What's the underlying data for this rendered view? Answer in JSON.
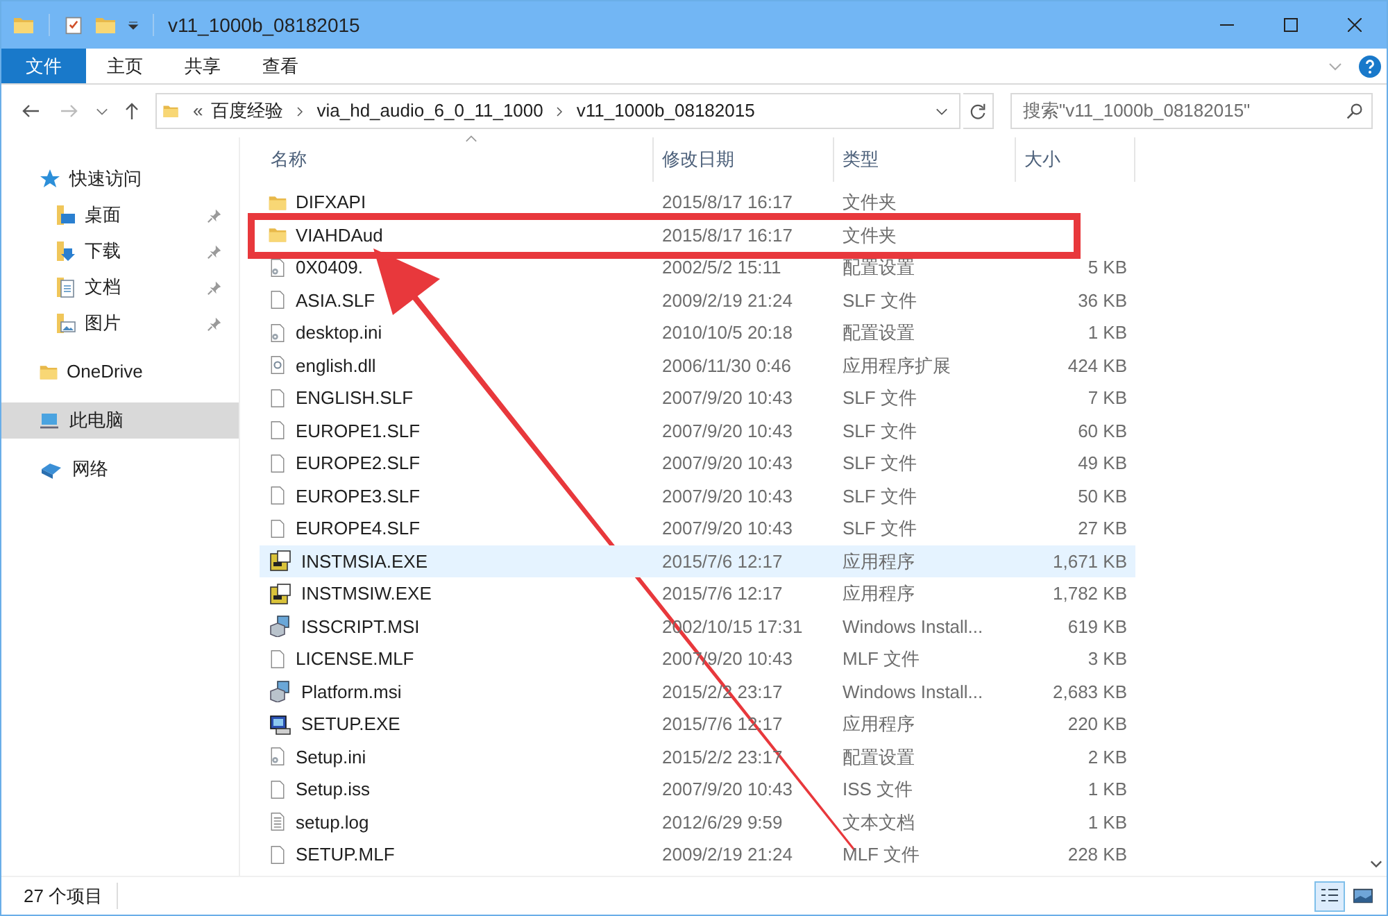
{
  "window": {
    "title": "v11_1000b_08182015"
  },
  "ribbon_tabs": [
    {
      "label": "文件",
      "selected": true
    },
    {
      "label": "主页",
      "selected": false
    },
    {
      "label": "共享",
      "selected": false
    },
    {
      "label": "查看",
      "selected": false
    }
  ],
  "breadcrumb": {
    "overflow": "«",
    "parts": [
      "百度经验",
      "via_hd_audio_6_0_11_1000",
      "v11_1000b_08182015"
    ]
  },
  "search": {
    "placeholder": "搜索\"v11_1000b_08182015\""
  },
  "sidebar": {
    "items": [
      {
        "label": "快速访问",
        "kind": "star",
        "pinned": false,
        "selected": false,
        "children": [
          {
            "label": "桌面",
            "kind": "desktop",
            "pinned": true,
            "selected": false
          },
          {
            "label": "下载",
            "kind": "download",
            "pinned": true,
            "selected": false
          },
          {
            "label": "文档",
            "kind": "docs",
            "pinned": true,
            "selected": false
          },
          {
            "label": "图片",
            "kind": "pictures",
            "pinned": true,
            "selected": false
          }
        ]
      },
      {
        "label": "OneDrive",
        "kind": "folder",
        "pinned": false,
        "selected": false
      },
      {
        "label": "此电脑",
        "kind": "pc",
        "pinned": false,
        "selected": true
      },
      {
        "label": "网络",
        "kind": "network",
        "pinned": false,
        "selected": false
      }
    ]
  },
  "table": {
    "columns": [
      "名称",
      "修改日期",
      "类型",
      "大小"
    ],
    "rows": [
      {
        "kind": "folder",
        "name": "DIFXAPI",
        "date": "2015/8/17 16:17",
        "type": "文件夹",
        "size": "",
        "selected": false
      },
      {
        "kind": "folder",
        "name": "VIAHDAud",
        "date": "2015/8/17 16:17",
        "type": "文件夹",
        "size": "",
        "selected": false
      },
      {
        "kind": "ini",
        "name": "0X0409.",
        "date": "2002/5/2 15:11",
        "type": "配置设置",
        "size": "5 KB",
        "selected": false
      },
      {
        "kind": "file",
        "name": "ASIA.SLF",
        "date": "2009/2/19 21:24",
        "type": "SLF 文件",
        "size": "36 KB",
        "selected": false
      },
      {
        "kind": "ini",
        "name": "desktop.ini",
        "date": "2010/10/5 20:18",
        "type": "配置设置",
        "size": "1 KB",
        "selected": false
      },
      {
        "kind": "dll",
        "name": "english.dll",
        "date": "2006/11/30 0:46",
        "type": "应用程序扩展",
        "size": "424 KB",
        "selected": false
      },
      {
        "kind": "file",
        "name": "ENGLISH.SLF",
        "date": "2007/9/20 10:43",
        "type": "SLF 文件",
        "size": "7 KB",
        "selected": false
      },
      {
        "kind": "file",
        "name": "EUROPE1.SLF",
        "date": "2007/9/20 10:43",
        "type": "SLF 文件",
        "size": "60 KB",
        "selected": false
      },
      {
        "kind": "file",
        "name": "EUROPE2.SLF",
        "date": "2007/9/20 10:43",
        "type": "SLF 文件",
        "size": "49 KB",
        "selected": false
      },
      {
        "kind": "file",
        "name": "EUROPE3.SLF",
        "date": "2007/9/20 10:43",
        "type": "SLF 文件",
        "size": "50 KB",
        "selected": false
      },
      {
        "kind": "file",
        "name": "EUROPE4.SLF",
        "date": "2007/9/20 10:43",
        "type": "SLF 文件",
        "size": "27 KB",
        "selected": false
      },
      {
        "kind": "exe",
        "name": "INSTMSIA.EXE",
        "date": "2015/7/6 12:17",
        "type": "应用程序",
        "size": "1,671 KB",
        "selected": true
      },
      {
        "kind": "exe",
        "name": "INSTMSIW.EXE",
        "date": "2015/7/6 12:17",
        "type": "应用程序",
        "size": "1,782 KB",
        "selected": false
      },
      {
        "kind": "msi",
        "name": "ISSCRIPT.MSI",
        "date": "2002/10/15 17:31",
        "type": "Windows Install...",
        "size": "619 KB",
        "selected": false
      },
      {
        "kind": "file",
        "name": "LICENSE.MLF",
        "date": "2007/9/20 10:43",
        "type": "MLF 文件",
        "size": "3 KB",
        "selected": false
      },
      {
        "kind": "msi",
        "name": "Platform.msi",
        "date": "2015/2/2 23:17",
        "type": "Windows Install...",
        "size": "2,683 KB",
        "selected": false
      },
      {
        "kind": "setup",
        "name": "SETUP.EXE",
        "date": "2015/7/6 12:17",
        "type": "应用程序",
        "size": "220 KB",
        "selected": false
      },
      {
        "kind": "ini",
        "name": "Setup.ini",
        "date": "2015/2/2 23:17",
        "type": "配置设置",
        "size": "2 KB",
        "selected": false
      },
      {
        "kind": "file",
        "name": "Setup.iss",
        "date": "2007/9/20 10:43",
        "type": "ISS 文件",
        "size": "1 KB",
        "selected": false
      },
      {
        "kind": "text",
        "name": "setup.log",
        "date": "2012/6/29 9:59",
        "type": "文本文档",
        "size": "1 KB",
        "selected": false
      },
      {
        "kind": "file",
        "name": "SETUP.MLF",
        "date": "2009/2/19 21:24",
        "type": "MLF 文件",
        "size": "228 KB",
        "selected": false
      }
    ]
  },
  "status_bar": {
    "count": "27 个项目"
  }
}
